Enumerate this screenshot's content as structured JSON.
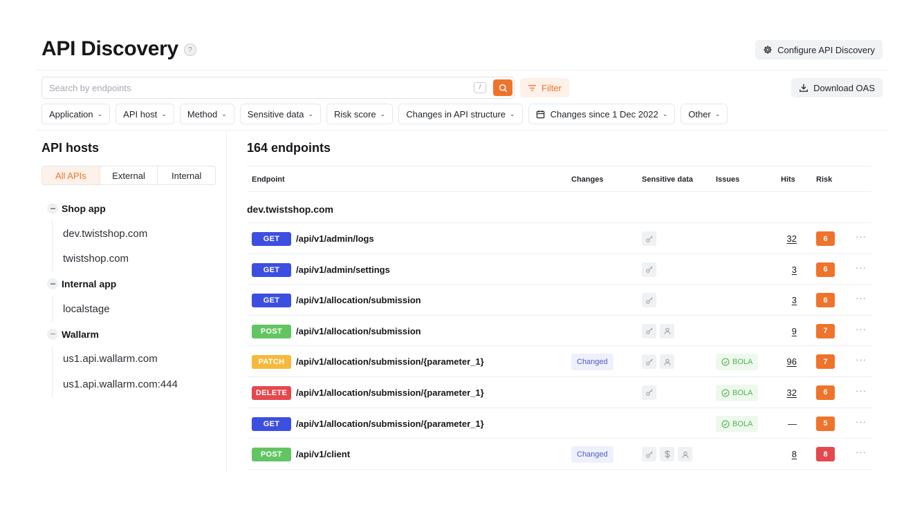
{
  "header": {
    "title": "API Discovery",
    "help_icon": "question-circle-icon",
    "configure_label": "Configure API Discovery",
    "configure_icon": "gear-icon"
  },
  "search": {
    "placeholder": "Search by endpoints",
    "value": "",
    "shortcut": "/",
    "search_icon": "search-icon"
  },
  "filter": {
    "label": "Filter",
    "icon": "filter-icon"
  },
  "download": {
    "label": "Download OAS",
    "icon": "download-icon"
  },
  "filter_chips": [
    {
      "label": "Application"
    },
    {
      "label": "API host"
    },
    {
      "label": "Method"
    },
    {
      "label": "Sensitive data"
    },
    {
      "label": "Risk score"
    },
    {
      "label": "Changes in API structure"
    },
    {
      "label": "Changes since 1 Dec 2022",
      "icon": "calendar-icon"
    },
    {
      "label": "Other"
    }
  ],
  "sidebar": {
    "title": "API hosts",
    "tabs": [
      {
        "label": "All APIs",
        "active": true
      },
      {
        "label": "External",
        "active": false
      },
      {
        "label": "Internal",
        "active": false
      }
    ],
    "groups": [
      {
        "label": "Shop app",
        "hosts": [
          "dev.twistshop.com",
          "twistshop.com"
        ]
      },
      {
        "label": "Internal app",
        "hosts": [
          "localstage"
        ]
      },
      {
        "label": "Wallarm",
        "hosts": [
          "us1.api.wallarm.com",
          "us1.api.wallarm.com:444"
        ]
      }
    ]
  },
  "main": {
    "title": "164 endpoints",
    "columns": {
      "endpoint": "Endpoint",
      "changes": "Changes",
      "sensitive": "Sensitive data",
      "issues": "Issues",
      "hits": "Hits",
      "risk": "Risk"
    },
    "host_group": "dev.twistshop.com",
    "rows": [
      {
        "method": "GET",
        "path": "/api/v1/admin/logs",
        "changes": "",
        "sensitive": [
          "key"
        ],
        "issue": "",
        "hits": "32",
        "risk": "6"
      },
      {
        "method": "GET",
        "path": "/api/v1/admin/settings",
        "changes": "",
        "sensitive": [
          "key"
        ],
        "issue": "",
        "hits": "3",
        "risk": "6"
      },
      {
        "method": "GET",
        "path": "/api/v1/allocation/submission",
        "changes": "",
        "sensitive": [
          "key"
        ],
        "issue": "",
        "hits": "3",
        "risk": "6"
      },
      {
        "method": "POST",
        "path": "/api/v1/allocation/submission",
        "changes": "",
        "sensitive": [
          "key",
          "user"
        ],
        "issue": "",
        "hits": "9",
        "risk": "7"
      },
      {
        "method": "PATCH",
        "path": "/api/v1/allocation/submission/{parameter_1}",
        "changes": "Changed",
        "sensitive": [
          "key",
          "user"
        ],
        "issue": "BOLA",
        "hits": "96",
        "risk": "7"
      },
      {
        "method": "DELETE",
        "path": "/api/v1/allocation/submission/{parameter_1}",
        "changes": "",
        "sensitive": [
          "key"
        ],
        "issue": "BOLA",
        "hits": "32",
        "risk": "6"
      },
      {
        "method": "GET",
        "path": "/api/v1/allocation/submission/{parameter_1}",
        "changes": "",
        "sensitive": [],
        "issue": "BOLA",
        "hits": "—",
        "risk": "5"
      },
      {
        "method": "POST",
        "path": "/api/v1/client",
        "changes": "Changed",
        "sensitive": [
          "key",
          "dollar",
          "user"
        ],
        "issue": "",
        "hits": "8",
        "risk": "8"
      }
    ],
    "more_label": "···"
  },
  "colors": {
    "accent": "#f0732b",
    "method_get": "#3d4fe0",
    "method_post": "#62c562",
    "method_patch": "#f7b93c",
    "method_delete": "#e5484d",
    "risk_orange": "#f0732b",
    "risk_red": "#e5484d",
    "issue_green": "#4fb04f",
    "changed_blue": "#4b5bc7"
  }
}
